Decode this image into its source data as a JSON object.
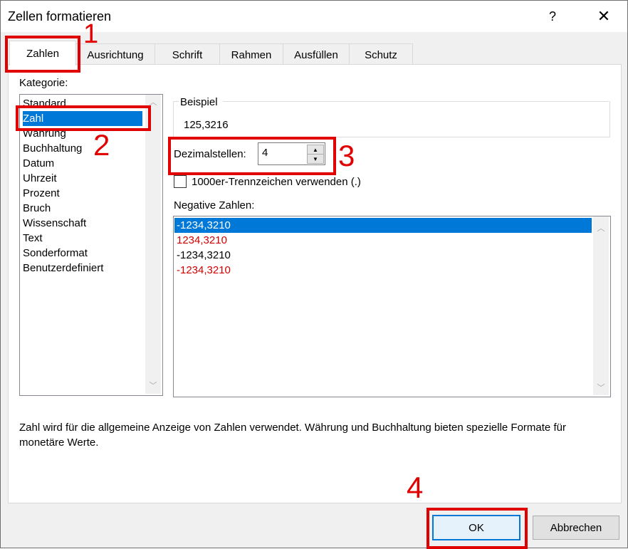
{
  "window": {
    "title": "Zellen formatieren",
    "help_glyph": "?",
    "close_glyph": "✕"
  },
  "tabs": [
    {
      "label": "Zahlen"
    },
    {
      "label": "Ausrichtung"
    },
    {
      "label": "Schrift"
    },
    {
      "label": "Rahmen"
    },
    {
      "label": "Ausfüllen"
    },
    {
      "label": "Schutz"
    }
  ],
  "kategorie": {
    "label": "Kategorie:",
    "items": [
      "Standard",
      "Zahl",
      "Währung",
      "Buchhaltung",
      "Datum",
      "Uhrzeit",
      "Prozent",
      "Bruch",
      "Wissenschaft",
      "Text",
      "Sonderformat",
      "Benutzerdefiniert"
    ],
    "selected": "Zahl"
  },
  "beispiel": {
    "label": "Beispiel",
    "value": "125,3216"
  },
  "dezimalstellen": {
    "label": "Dezimalstellen:",
    "value": "4"
  },
  "trennzeichen": {
    "label": "1000er-Trennzeichen verwenden (.)",
    "checked": false
  },
  "negative": {
    "label": "Negative Zahlen:",
    "items": [
      {
        "text": "-1234,3210",
        "color": "#ffffff",
        "selected": true
      },
      {
        "text": "1234,3210",
        "color": "#d00000",
        "selected": false
      },
      {
        "text": "-1234,3210",
        "color": "#000000",
        "selected": false
      },
      {
        "text": "-1234,3210",
        "color": "#d00000",
        "selected": false
      }
    ]
  },
  "description": "Zahl wird für die allgemeine Anzeige von Zahlen verwendet. Währung und Buchhaltung bieten spezielle Formate für monetäre Werte.",
  "buttons": {
    "ok": "OK",
    "cancel": "Abbrechen"
  },
  "annotations": {
    "n1": "1",
    "n2": "2",
    "n3": "3",
    "n4": "4",
    "color": "#e00000"
  },
  "colors": {
    "selection": "#0078d7",
    "negative_red": "#d00000"
  }
}
